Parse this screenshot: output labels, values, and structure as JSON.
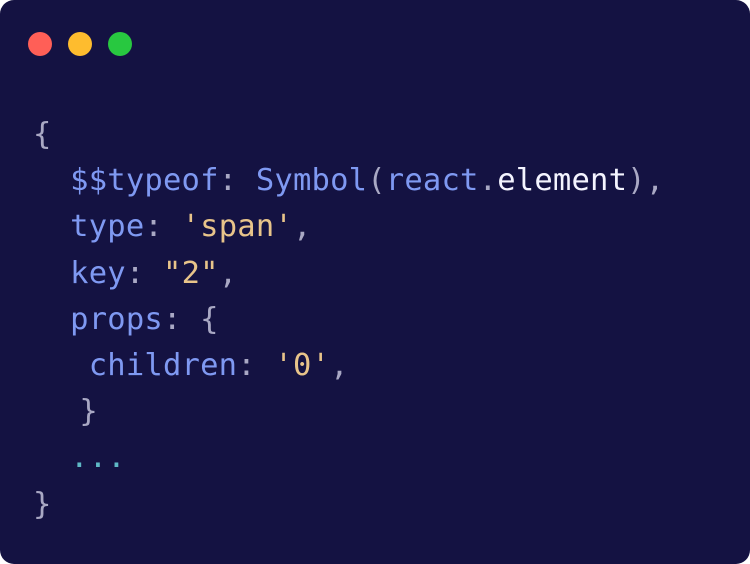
{
  "window": {
    "buttons": {
      "close_color": "#ff5f57",
      "minimize_color": "#febc2e",
      "maximize_color": "#28c840"
    }
  },
  "code": {
    "open_brace": "{",
    "typeof_key": "$$typeof",
    "typeof_colon": ":",
    "symbol_fn": "Symbol",
    "paren_open": "(",
    "react_ident": "react",
    "dot": ".",
    "element_ident": "element",
    "paren_close_comma": "),",
    "type_key": "type",
    "type_colon": ":",
    "type_value": "'span'",
    "type_comma": ",",
    "key_key": "key",
    "key_colon": ":",
    "key_value": "\"2\"",
    "key_comma": ",",
    "props_key": "props",
    "props_colon": ":",
    "props_open": "{",
    "children_key": "children",
    "children_colon": ":",
    "children_value": "'0'",
    "children_comma": ",",
    "props_close": "}",
    "ellipsis": "...",
    "close_brace": "}"
  }
}
